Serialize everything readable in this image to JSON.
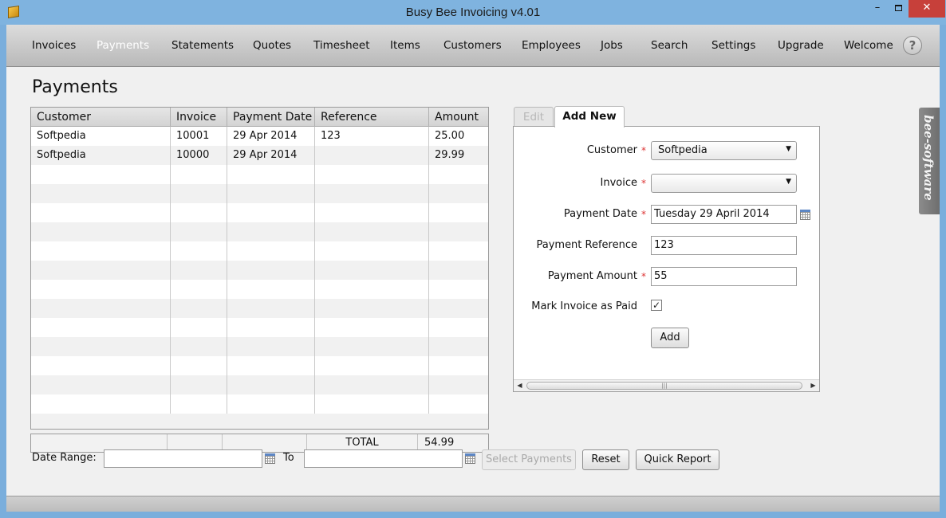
{
  "window": {
    "title": "Busy Bee Invoicing v4.01",
    "minimize": "–",
    "close": "✕"
  },
  "nav": {
    "items": [
      "Invoices",
      "Payments",
      "Statements",
      "Quotes",
      "Timesheet",
      "Items",
      "Customers",
      "Employees",
      "Jobs",
      "Search",
      "Settings",
      "Upgrade",
      "Welcome"
    ],
    "active": "Payments",
    "help": "?"
  },
  "page": {
    "title": "Payments"
  },
  "grid": {
    "columns": [
      "Customer",
      "Invoice",
      "Payment Date",
      "Reference",
      "Amount"
    ],
    "rows": [
      [
        "Softpedia",
        "10001",
        "29 Apr 2014",
        "123",
        "25.00"
      ],
      [
        "Softpedia",
        "10000",
        "29 Apr 2014",
        "",
        "29.99"
      ]
    ],
    "total_label": "TOTAL",
    "total_value": "54.99"
  },
  "form": {
    "tab_edit": "Edit",
    "tab_add_new": "Add New",
    "customer_label": "Customer",
    "customer_value": "Softpedia",
    "invoice_label": "Invoice",
    "invoice_value": "",
    "payment_date_label": "Payment Date",
    "payment_date_value": "Tuesday 29 April 2014",
    "payment_reference_label": "Payment Reference",
    "payment_reference_value": "123",
    "payment_amount_label": "Payment Amount",
    "payment_amount_value": "55",
    "mark_paid_label": "Mark Invoice as Paid",
    "mark_paid_checked": "✓",
    "required_marker": "*",
    "add_button": "Add",
    "scroll_grip": "|||"
  },
  "side_tab": {
    "label": "bee-software"
  },
  "filters": {
    "date_range_label": "Date Range:",
    "from_value": "",
    "to_label": "To",
    "to_value": "",
    "select_payments_button": "Select Payments",
    "reset_button": "Reset",
    "quick_report_button": "Quick Report"
  },
  "colors": {
    "titlebar": "#7fb3df",
    "close_button": "#c7403a",
    "required": "#dd3333",
    "active_nav_text": "#ffffff"
  }
}
